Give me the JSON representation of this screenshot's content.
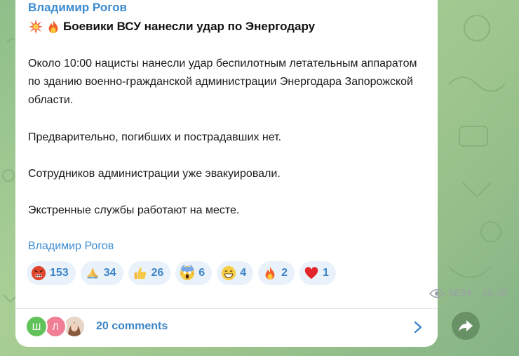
{
  "message": {
    "author": "Владимир Рогов",
    "headline": "Боевики ВСУ нанесли удар по Энергодару",
    "headline_icons": [
      "collision-icon",
      "fire-icon"
    ],
    "paragraphs": [
      "Около 10:00 нацисты нанесли удар беспилотным летательным аппаратом по зданию военно-гражданской администрации Энергодара Запорожской области.",
      "Предварительно, погибших и пострадавших нет.",
      "Сотрудников администрации уже эвакуировали.",
      "Экстренные службы работают на месте."
    ],
    "signature": "Владимир Рогов",
    "reactions": [
      {
        "icon": "angry-face-icon",
        "count": "153"
      },
      {
        "icon": "praying-hands-icon",
        "count": "34"
      },
      {
        "icon": "thumbs-up-icon",
        "count": "26"
      },
      {
        "icon": "screaming-face-icon",
        "count": "6"
      },
      {
        "icon": "grinning-face-icon",
        "count": "4"
      },
      {
        "icon": "fire-icon",
        "count": "2"
      },
      {
        "icon": "red-heart-icon",
        "count": "1"
      }
    ],
    "views": "5834",
    "time": "10:38"
  },
  "comments": {
    "avatars": [
      {
        "letter": "Ш",
        "color": "#62c25a"
      },
      {
        "letter": "Л",
        "color": "#f07e95"
      },
      {
        "letter": "",
        "color": "#d7b9a3"
      }
    ],
    "label": "20 comments"
  },
  "share_icon": "share-arrow-icon",
  "colors": {
    "accent": "#3b84c6",
    "reaction_bg": "#e9f2fb",
    "background": "#9cc48c"
  }
}
